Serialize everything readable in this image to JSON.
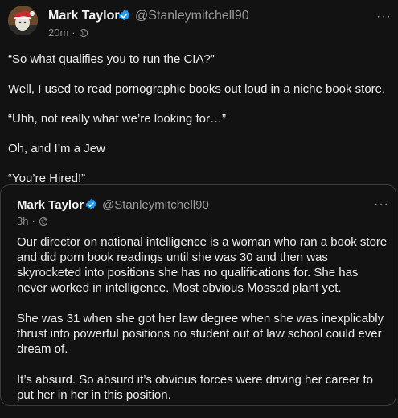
{
  "post": {
    "author_name": "Mark Taylor",
    "handle": "@Stanleymitchell90",
    "time": "20m",
    "separator": "·",
    "more": "···",
    "paragraphs": [
      "“So what qualifies you to run the CIA?”",
      "Well, I used to read pornographic books out loud in a niche book store.",
      "“Uhh, not really what we’re looking for…”",
      "Oh, and I’m a Jew",
      "“You’re Hired!”"
    ]
  },
  "quoted": {
    "author_name": "Mark Taylor",
    "handle": "@Stanleymitchell90",
    "time": "3h",
    "separator": "·",
    "more": "···",
    "paragraphs": [
      "Our director on national intelligence is a woman who ran a book store and did porn book readings until she was 30 and then was skyrocketed into positions she has no qualifications for. She has never worked in intelligence. Most obvious Mossad plant yet.",
      "She was 31 when she got her law degree when she was inexplicably thrust into powerful positions no student out of law school could ever dream of.",
      "It’s absurd. So absurd it’s obvious forces were driving her career to put her in her in this position."
    ]
  },
  "colors": {
    "background": "#121212",
    "verified_blue": "#1d9bf0",
    "muted_text": "#8c8c8c"
  },
  "icons": {
    "verified": "verified-badge-icon",
    "audience": "globe-icon",
    "more": "more-options-icon"
  }
}
